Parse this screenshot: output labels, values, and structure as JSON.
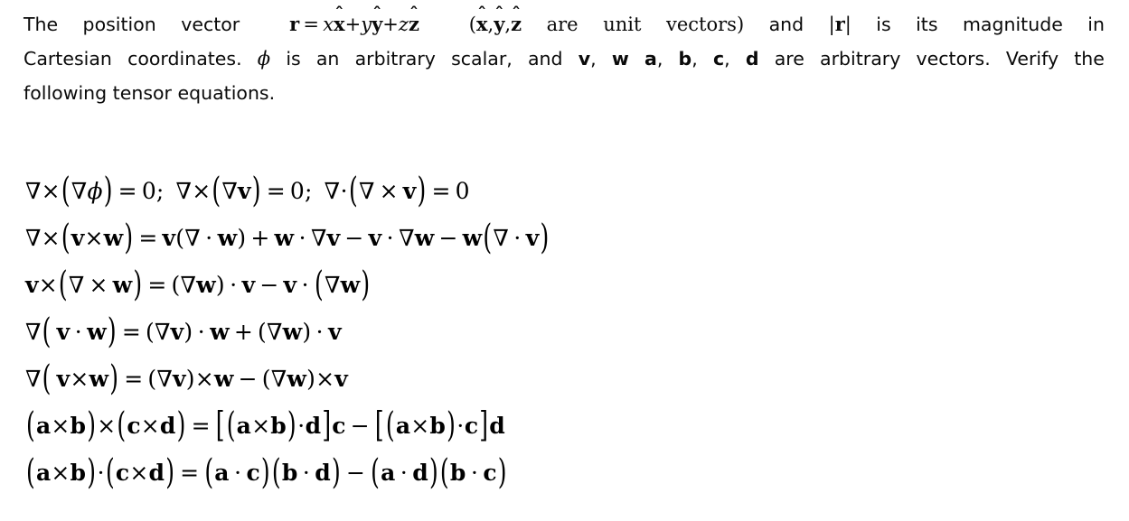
{
  "document": {
    "background_color": "#ffffff",
    "text_color": "#0a0a0a"
  },
  "prose": {
    "full_text": "The position vector r = x x̂ + y ŷ + z ẑ (x̂, ŷ, ẑ are unit vectors) and |r| is its magnitude in Cartesian coordinates. ϕ is an arbitrary scalar, and v, w a, b, c, d are arbitrary vectors. Verify the following tensor equations.",
    "line1": {
      "seg1": "The position vector",
      "math_r": "r",
      "eq": "=",
      "x": "x",
      "xhat_base": "x",
      "plus1": "+",
      "y": "y",
      "yhat_base": "y",
      "plus2": "+",
      "z": "z",
      "zhat_base": "z",
      "hat": "ˆ",
      "paren_open": "(",
      "hatlist_x": "x",
      "comma1": ",",
      "hatlist_y": "y",
      "comma2": ",",
      "hatlist_z": "z",
      "seg2": "are unit vectors)",
      "seg3": "and",
      "magnitude_bar": "|",
      "magnitude_r": "r",
      "seg4": "is its magnitude in"
    },
    "line2": {
      "seg1": "Cartesian coordinates.",
      "phi": "ϕ",
      "seg2": "is an arbitrary scalar, and",
      "v": "v",
      "comma1": ",",
      "w": "w",
      "a": "a",
      "comma2": ",",
      "b": "b",
      "comma3": ",",
      "c": "c",
      "comma4": ",",
      "d": "d",
      "seg3": "are arbitrary vectors. Verify the"
    },
    "line3": {
      "seg1": "following tensor equations."
    }
  },
  "equations": {
    "count": 7,
    "list": [
      {
        "id": "eq-curl-of-grad-and-div-of-curl",
        "latex": "\\nabla\\times(\\nabla\\phi)=0;\\; \\nabla\\times(\\nabla\\mathbf{v})=0;\\; \\nabla\\cdot(\\nabla\\times\\mathbf{v})=0",
        "plain": "∇×(∇ϕ) = 0; ∇×(∇v) = 0; ∇·(∇×v) = 0",
        "tokens": {
          "nabla": "∇",
          "cross": "×",
          "dot": "⋅",
          "phi": "ϕ",
          "v": "v",
          "zero": "0",
          "semicolon": ";",
          "equals": "=",
          "paren_open": "(",
          "paren_close": ")"
        }
      },
      {
        "id": "eq-curl-of-cross-product",
        "latex": "\\nabla\\times(\\mathbf{v}\\times\\mathbf{w})=\\mathbf{v}(\\nabla\\cdot\\mathbf{w})+\\mathbf{w}\\cdot\\nabla\\mathbf{v}-\\mathbf{v}\\cdot\\nabla\\mathbf{w}-\\mathbf{w}(\\nabla\\cdot\\mathbf{v})",
        "plain": "∇×(v×w) = v(∇·w) + w·∇v − v·∇w − w(∇·v)"
      },
      {
        "id": "eq-v-cross-curl-w",
        "latex": "\\mathbf{v}\\times(\\nabla\\times\\mathbf{w})=(\\nabla\\mathbf{w})\\cdot\\mathbf{v}-\\mathbf{v}\\cdot(\\nabla\\mathbf{w})",
        "plain": "v×(∇×w) = (∇w)·v − v·(∇w)"
      },
      {
        "id": "eq-grad-of-dot-product",
        "latex": "\\nabla(\\mathbf{v}\\cdot\\mathbf{w})=(\\nabla\\mathbf{v})\\cdot\\mathbf{w}+(\\nabla\\mathbf{w})\\cdot\\mathbf{v}",
        "plain": "∇(v·w) = (∇v)·w + (∇w)·v"
      },
      {
        "id": "eq-grad-of-cross-product",
        "latex": "\\nabla(\\mathbf{v}\\times\\mathbf{w})=(\\nabla\\mathbf{v})\\times\\mathbf{w}-(\\nabla\\mathbf{w})\\times\\mathbf{v}",
        "plain": "∇(v×w) = (∇v)×w − (∇w)×v"
      },
      {
        "id": "eq-quadruple-cross-product",
        "latex": "(\\mathbf{a}\\times\\mathbf{b})\\times(\\mathbf{c}\\times\\mathbf{d})=\\left[(\\mathbf{a}\\times\\mathbf{b})\\cdot\\mathbf{d}\\right]\\mathbf{c}-\\left[(\\mathbf{a}\\times\\mathbf{b})\\cdot\\mathbf{c}\\right]\\mathbf{d}",
        "plain": "(a×b)×(c×d) = [(a×b)·d]c − [(a×b)·c]d"
      },
      {
        "id": "eq-binet-cauchy-identity",
        "latex": "(\\mathbf{a}\\times\\mathbf{b})\\cdot(\\mathbf{c}\\times\\mathbf{d})=(\\mathbf{a}\\cdot\\mathbf{c})(\\mathbf{b}\\cdot\\mathbf{d})-(\\mathbf{a}\\cdot\\mathbf{d})(\\mathbf{b}\\cdot\\mathbf{c})",
        "plain": "(a×b)·(c×d) = (a·c)(b·d) − (a·d)(b·c)"
      }
    ],
    "symbols": {
      "nabla": "∇",
      "cross": "×",
      "cdot": "⋅",
      "minus": "−",
      "plus": "+",
      "equals": "=",
      "semicolon": ";",
      "zero": "0",
      "paren_open": "(",
      "paren_close": ")",
      "bracket_open": "[",
      "bracket_close": "]",
      "hat": "ˆ",
      "phi": "ϕ",
      "bar": "|",
      "comma": ",",
      "v": "v",
      "w": "w",
      "a": "a",
      "b": "b",
      "c": "c",
      "d": "d",
      "x": "x",
      "y": "y",
      "z": "z",
      "r": "r"
    }
  }
}
